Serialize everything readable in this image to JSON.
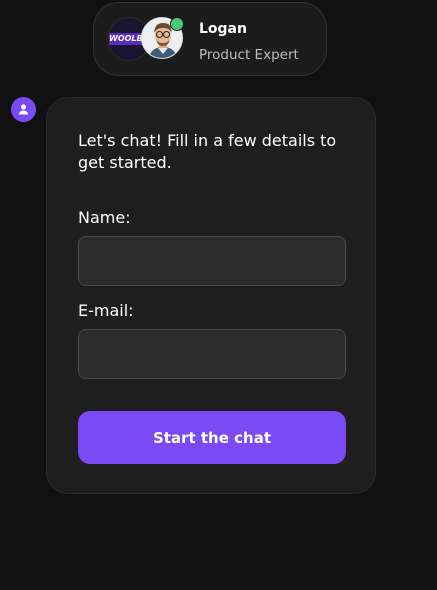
{
  "agent": {
    "name": "Logan",
    "role": "Product Expert",
    "brand_logo_text": "WOOLBET",
    "status": "online",
    "status_color": "#4cc977"
  },
  "bot_indicator": {
    "icon": "user-icon"
  },
  "form": {
    "intro": "Let's chat! Fill in a few details to get started.",
    "name_label": "Name:",
    "name_value": "",
    "email_label": "E-mail:",
    "email_value": "",
    "submit_label": "Start the chat"
  },
  "colors": {
    "background": "#111111",
    "card": "#1e1e1e",
    "accent": "#7a4bf5",
    "input_bg": "#2b2b2b"
  }
}
